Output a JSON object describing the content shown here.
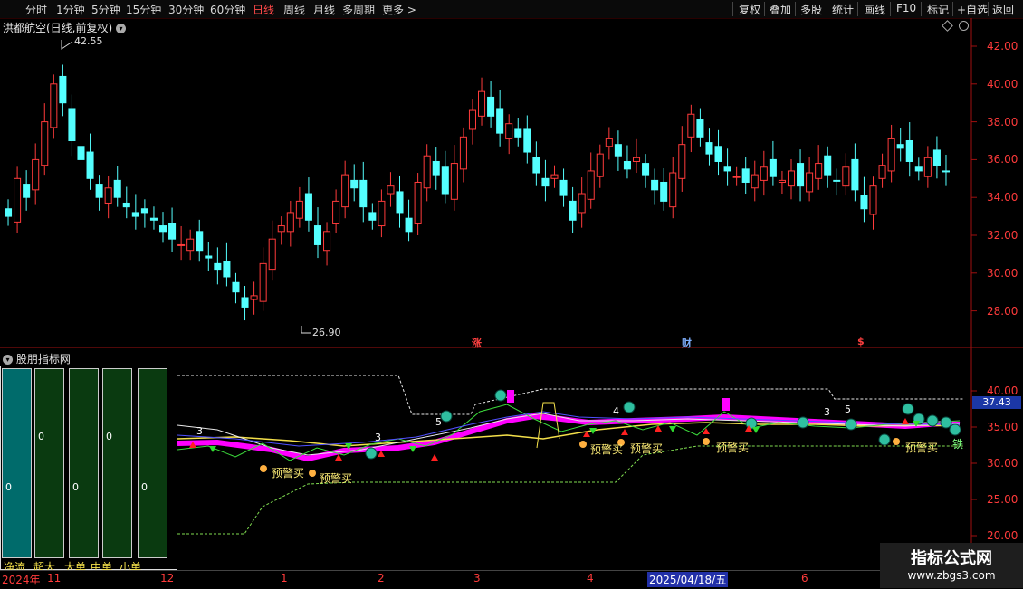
{
  "toolbar": {
    "periods": [
      "分时",
      "1分钟",
      "5分钟",
      "15分钟",
      "30分钟",
      "60分钟",
      "日线",
      "周线",
      "月线",
      "多周期",
      "更多 >"
    ],
    "active_period": "日线",
    "right_buttons": [
      "复权",
      "叠加",
      "多股",
      "统计",
      "画线",
      "F10",
      "标记",
      "+自选",
      "返回"
    ]
  },
  "main_chart": {
    "title": "洪都航空(日线,前复权)",
    "y_ticks": [
      "42.00",
      "40.00",
      "38.00",
      "36.00",
      "34.00",
      "32.00",
      "30.00",
      "28.00"
    ],
    "high_mark": "42.55",
    "low_mark": "26.90",
    "events": [
      "涨",
      "财",
      "$"
    ]
  },
  "indicator": {
    "title": "股朋指标网",
    "y_ticks": [
      "40.00",
      "35.00",
      "30.00",
      "25.00",
      "20.00"
    ],
    "current_value": "37.43",
    "side_mark": "铁",
    "bars": [
      {
        "label": "净流",
        "value": "0"
      },
      {
        "label": "超大",
        "value": "0"
      },
      {
        "label": "大单",
        "value": "0"
      },
      {
        "label": "中单",
        "value": "0"
      },
      {
        "label": "小单",
        "value": "0"
      }
    ],
    "signal_label": "预警买",
    "numbers": [
      "3",
      "3",
      "5",
      "4",
      "3",
      "5"
    ]
  },
  "time_axis": {
    "year": "2024年",
    "months": [
      "11",
      "12",
      "1",
      "2",
      "3",
      "4",
      "6"
    ],
    "highlight_date": "2025/04/18/五"
  },
  "watermark": {
    "title": "指标公式网",
    "url": "www.zbgs3.com"
  },
  "colors": {
    "up": "#ff3b3b",
    "down": "#54ffff",
    "magenta": "#ff00ff",
    "yellow": "#f4e04a",
    "panel_bg": "#000000",
    "bar_teal": "#006b6b",
    "bar_green": "#0a3a10"
  }
}
